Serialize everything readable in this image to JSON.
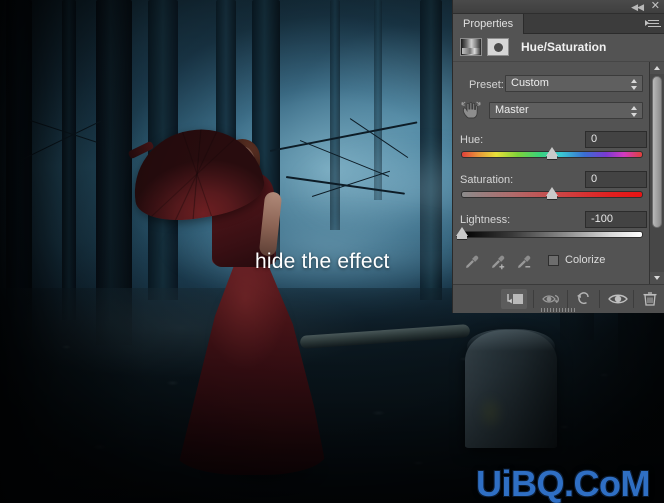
{
  "app": {
    "panel_topbar": {
      "collapse_icon": "◀◀",
      "close_icon": "✕"
    }
  },
  "panel": {
    "tab_label": "Properties",
    "menu_icon": "panel-menu-icon",
    "title": "Hue/Saturation",
    "adjustment_thumb_icon": "hue-saturation-layer-thumbnail",
    "mask_thumb_icon": "layer-mask-thumbnail",
    "preset": {
      "label": "Preset:",
      "value": "Custom"
    },
    "channel": {
      "hand_icon": "on-image-adjustment-hand-icon",
      "value": "Master"
    },
    "sliders": [
      {
        "label": "Hue:",
        "value": "0",
        "thumb_percent": 50,
        "track": "hue-rainbow"
      },
      {
        "label": "Saturation:",
        "value": "0",
        "thumb_percent": 50,
        "track": "saturation-gray-to-red"
      },
      {
        "label": "Lightness:",
        "value": "-100",
        "thumb_percent": 0,
        "track": "lightness-black-to-white"
      }
    ],
    "eyedroppers": [
      {
        "name": "eyedropper-sample"
      },
      {
        "name": "eyedropper-add-to-sample"
      },
      {
        "name": "eyedropper-subtract-from-sample"
      }
    ],
    "colorize": {
      "label": "Colorize",
      "checked": false
    },
    "footer_buttons": [
      {
        "name": "clip-to-layer-button",
        "icon": "clip-to-layer-icon"
      },
      {
        "name": "toggle-previous-state-button",
        "icon": "eye-arrow-icon"
      },
      {
        "name": "reset-button",
        "icon": "reset-arrow-icon"
      },
      {
        "name": "toggle-layer-visibility-button",
        "icon": "eye-icon"
      },
      {
        "name": "delete-adjustment-layer-button",
        "icon": "trash-icon"
      }
    ],
    "scrollbar": {
      "up_arrow": "scroll-up-arrow",
      "down_arrow": "scroll-down-arrow"
    }
  },
  "canvas": {
    "annotation_text": "hide the effect",
    "watermark_text": "UiBQ.CoM",
    "subject": "woman-in-red-dress-with-umbrella",
    "scene": "misty-blue-forest-with-gravestone"
  },
  "colors": {
    "panel_bg": "#535353",
    "panel_header_bg": "#3c3c3c",
    "field_bg": "#434343",
    "text": "#d4d4d4",
    "watermark_blue": "#2f6fc4",
    "annotation_white": "#ffffff",
    "dress_red": "#5a1a1f",
    "mist_blue": "#2a5a72"
  }
}
